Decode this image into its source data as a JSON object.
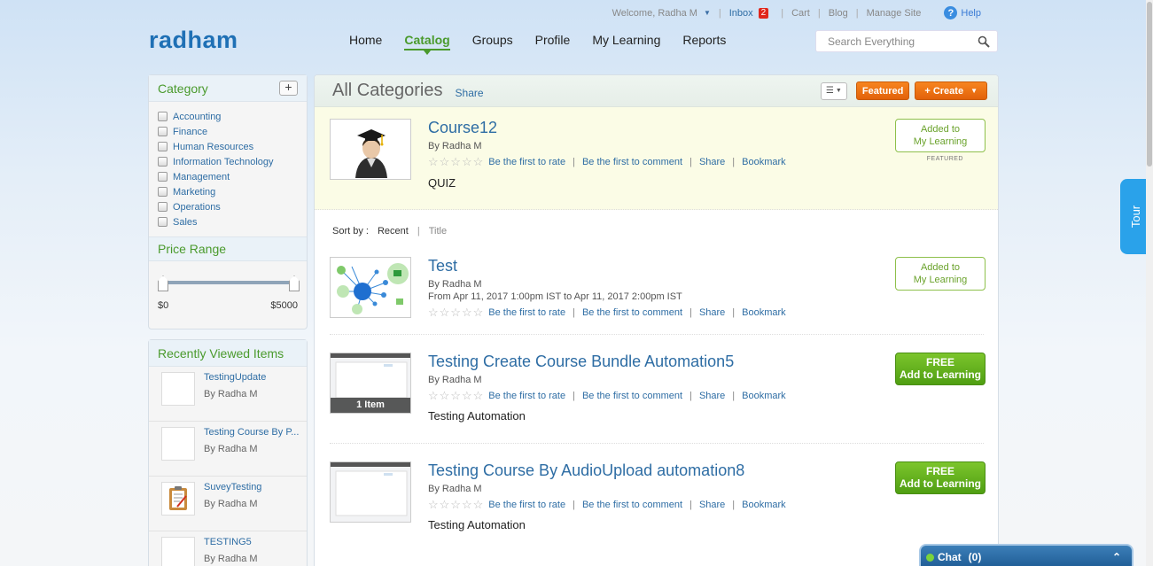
{
  "topbar": {
    "welcome": "Welcome, Radha M",
    "inbox": "Inbox",
    "inbox_count": "2",
    "cart": "Cart",
    "blog": "Blog",
    "manage_site": "Manage Site",
    "help": "Help"
  },
  "logo": "radham",
  "nav": {
    "home": "Home",
    "catalog": "Catalog",
    "groups": "Groups",
    "profile": "Profile",
    "my_learning": "My Learning",
    "reports": "Reports"
  },
  "search": {
    "placeholder": "Search Everything"
  },
  "category": {
    "title": "Category",
    "add": "+",
    "items": [
      "Accounting",
      "Finance",
      "Human Resources",
      "Information Technology",
      "Management",
      "Marketing",
      "Operations",
      "Sales"
    ]
  },
  "price_range": {
    "title": "Price Range",
    "min": "$0",
    "max": "$5000"
  },
  "recently_viewed": {
    "title": "Recently Viewed Items",
    "items": [
      {
        "title": "TestingUpdate",
        "by": "By Radha M"
      },
      {
        "title": "Testing Course By P...",
        "by": "By Radha M"
      },
      {
        "title": "SuveyTesting",
        "by": "By Radha M"
      },
      {
        "title": "TESTING5",
        "by": "By Radha M"
      }
    ]
  },
  "main": {
    "title": "All Categories",
    "share": "Share",
    "featured_btn": "Featured",
    "create_btn": "+ Create",
    "sort_by": "Sort by :",
    "sort_recent": "Recent",
    "sort_title": "Title"
  },
  "rating": {
    "stars": "☆☆☆☆☆",
    "rate": "Be the first to rate",
    "comment": "Be the first to comment",
    "share": "Share",
    "bookmark": "Bookmark"
  },
  "courses": [
    {
      "title": "Course12",
      "by": "By Radha M",
      "desc": "QUIZ",
      "action_line1": "Added to",
      "action_line2": "My Learning",
      "featured_label": "FEATURED"
    },
    {
      "title": "Test",
      "by": "By Radha M",
      "date": "From Apr 11, 2017 1:00pm IST to Apr 11, 2017 2:00pm IST",
      "action_line1": "Added to",
      "action_line2": "My Learning"
    },
    {
      "title": "Testing Create Course Bundle Automation5",
      "by": "By Radha M",
      "desc": "Testing Automation",
      "bundle": "1 Item",
      "action_line1": "FREE",
      "action_line2": "Add to Learning"
    },
    {
      "title": "Testing Course By AudioUpload automation8",
      "by": "By Radha M",
      "desc": "Testing Automation",
      "action_line1": "FREE",
      "action_line2": "Add to Learning"
    }
  ],
  "tour": "Tour",
  "chat": {
    "label": "Chat",
    "count": "(0)",
    "toggle": "⌃"
  }
}
